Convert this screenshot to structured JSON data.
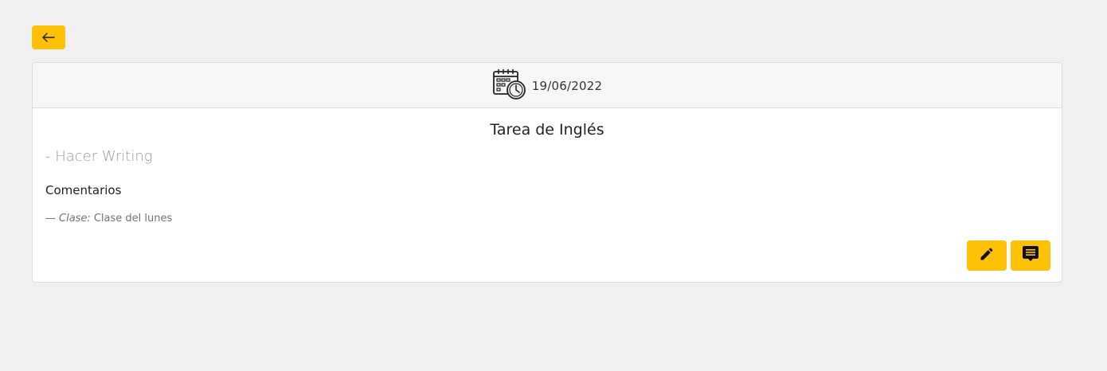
{
  "nav": {
    "back_icon": "arrow-left-icon"
  },
  "card": {
    "header": {
      "icon": "calendar-clock-icon",
      "date": "19/06/2022"
    },
    "title": "Tarea de Inglés",
    "description": "- Hacer Writing",
    "comments_heading": "Comentarios",
    "comment": {
      "dash": "—",
      "label": "Clase:",
      "text": "Clase del lunes"
    },
    "actions": {
      "edit_icon": "pencil-icon",
      "comment_icon": "comment-icon"
    }
  },
  "colors": {
    "accent": "#ffc107",
    "background": "#f0f0f0",
    "card": "#ffffff",
    "header": "#f7f7f7"
  }
}
